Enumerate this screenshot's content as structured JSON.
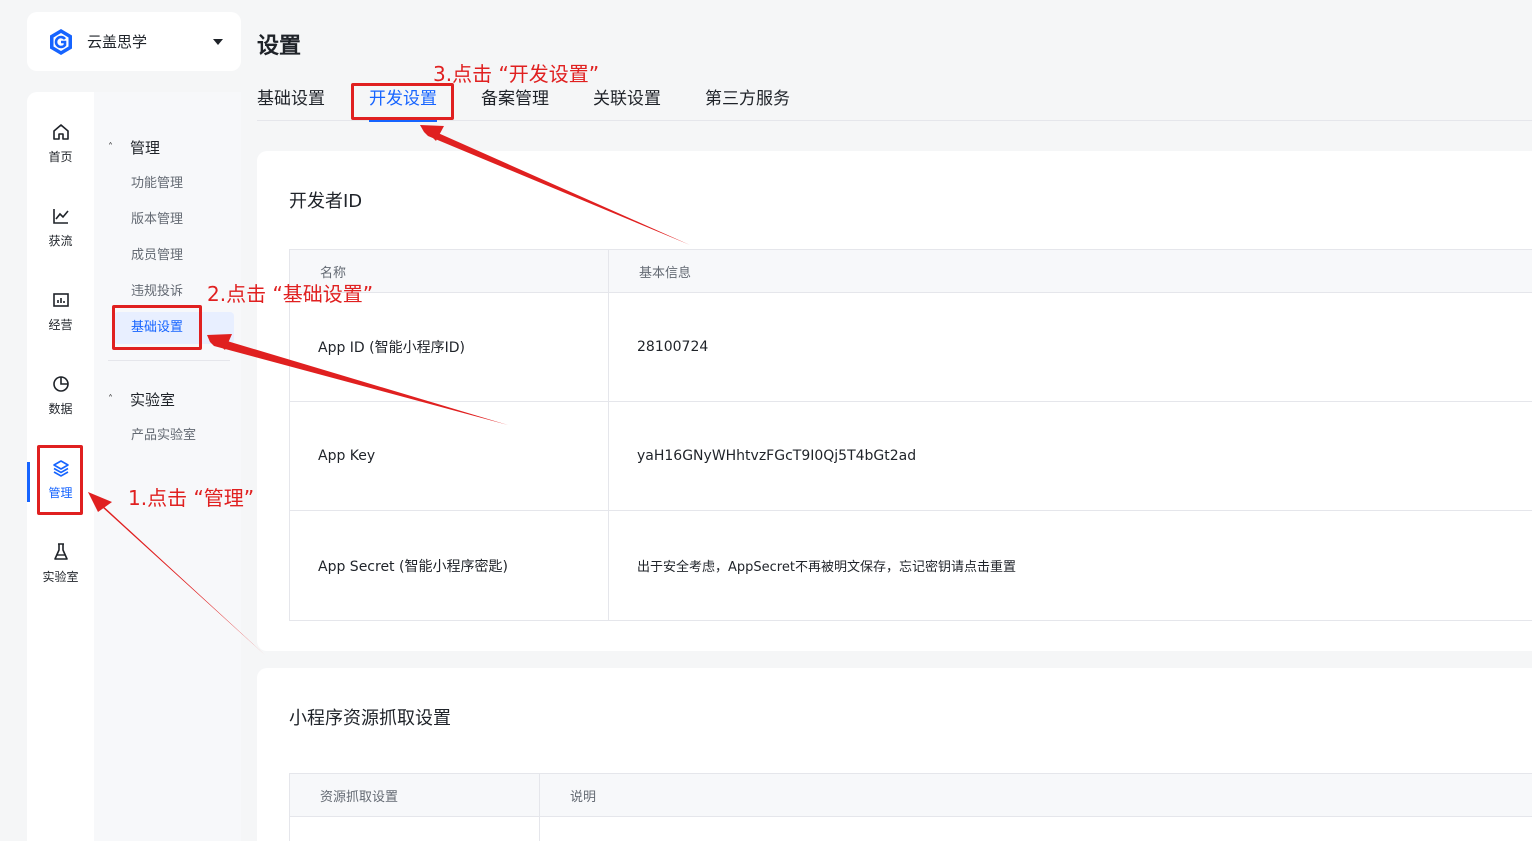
{
  "app": {
    "name": "云盖思学",
    "logo_icon": "app-logo-hexagon-g"
  },
  "rail": [
    {
      "label": "首页",
      "icon": "home-icon"
    },
    {
      "label": "获流",
      "icon": "line-chart-icon"
    },
    {
      "label": "经营",
      "icon": "bar-chart-icon"
    },
    {
      "label": "数据",
      "icon": "pie-chart-icon"
    },
    {
      "label": "管理",
      "icon": "layers-icon",
      "active": true
    },
    {
      "label": "实验室",
      "icon": "flask-icon"
    }
  ],
  "subnav": {
    "groups": [
      {
        "label": "管理",
        "items": [
          "功能管理",
          "版本管理",
          "成员管理",
          "违规投诉",
          "基础设置"
        ],
        "active_index": 4
      },
      {
        "label": "实验室",
        "items": [
          "产品实验室"
        ]
      }
    ]
  },
  "page": {
    "title": "设置",
    "tabs": [
      "基础设置",
      "开发设置",
      "备案管理",
      "关联设置",
      "第三方服务"
    ],
    "active_tab_index": 1
  },
  "developer_card": {
    "title": "开发者ID",
    "headers": [
      "名称",
      "基本信息"
    ],
    "rows": [
      {
        "name": "App ID (智能小程序ID)",
        "value": "28100724"
      },
      {
        "name": "App Key",
        "value": "yaH16GNyWHhtvzFGcT9I0Qj5T4bGt2ad"
      },
      {
        "name": "App Secret (智能小程序密匙)",
        "value": "出于安全考虑，AppSecret不再被明文保存，忘记密钥请点击重置"
      }
    ]
  },
  "resource_card": {
    "title": "小程序资源抓取设置",
    "headers": [
      "资源抓取设置",
      "说明"
    ]
  },
  "annotations": {
    "step1": "1.点击 “管理”",
    "step2": "2.点击 “基础设置”",
    "step3": "3.点击 “开发设置”",
    "color": "#e02020"
  },
  "colors": {
    "accent": "#1664ff",
    "annotation": "#e02020"
  }
}
